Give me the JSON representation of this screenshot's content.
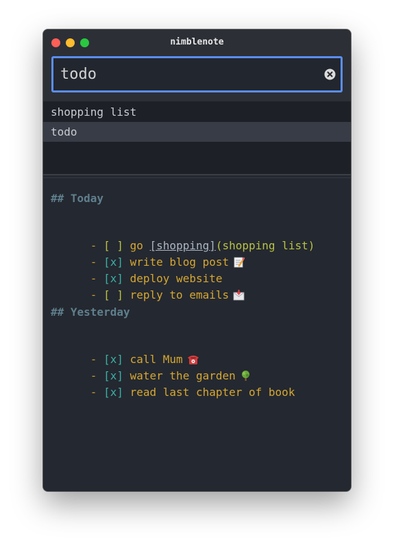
{
  "window": {
    "title": "nimblenote"
  },
  "search": {
    "value": "todo"
  },
  "results": [
    "shopping list",
    "todo"
  ],
  "editor": {
    "sections": [
      {
        "heading": "## Today",
        "items": [
          {
            "dash": "-",
            "checkbox": "[ ]",
            "text": "go",
            "link_text": "[shopping]",
            "link_target": "(shopping list)"
          },
          {
            "dash": "-",
            "checkbox": "[x]",
            "text": "write blog post",
            "emoji": "memo-icon"
          },
          {
            "dash": "-",
            "checkbox": "[x]",
            "text": "deploy website"
          },
          {
            "dash": "-",
            "checkbox": "[ ]",
            "text": "reply to emails",
            "emoji": "envelope-icon"
          }
        ]
      },
      {
        "heading": "## Yesterday",
        "items": [
          {
            "dash": "-",
            "checkbox": "[x]",
            "text": "call Mum",
            "emoji": "telephone-icon"
          },
          {
            "dash": "-",
            "checkbox": "[x]",
            "text": "water the garden",
            "emoji": "tree-icon"
          },
          {
            "dash": "-",
            "checkbox": "[x]",
            "text": "read last chapter of book"
          }
        ]
      }
    ]
  },
  "colors": {
    "accent": "#5b8ef2",
    "background": "#242830",
    "heading": "#5f7f8c",
    "text": "#d6a732",
    "checkbox_open": "#b9c244",
    "checkbox_done": "#3ab0a5"
  }
}
